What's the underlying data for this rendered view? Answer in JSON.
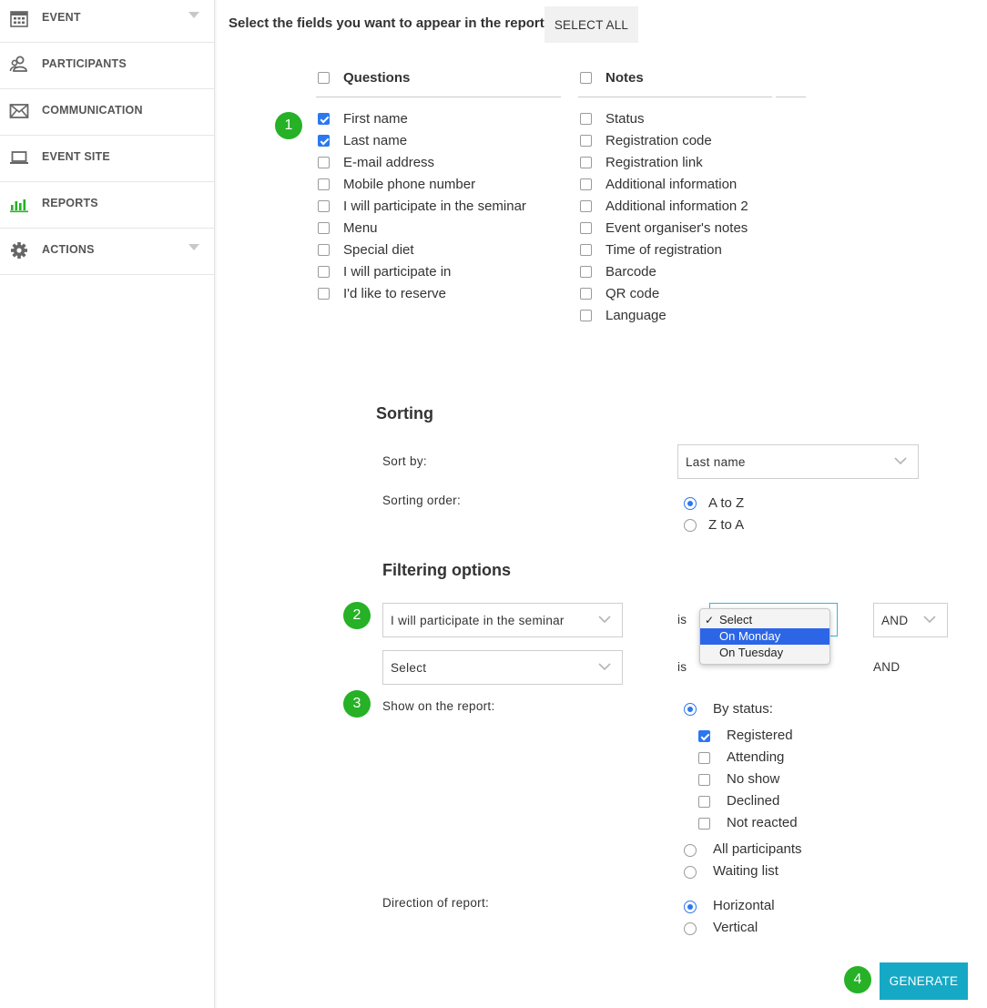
{
  "sidebar": {
    "items": [
      {
        "label": "EVENT",
        "icon": "calendar-icon",
        "has_caret": true
      },
      {
        "label": "PARTICIPANTS",
        "icon": "people-icon",
        "has_caret": false
      },
      {
        "label": "COMMUNICATION",
        "icon": "envelope-icon",
        "has_caret": false
      },
      {
        "label": "EVENT SITE",
        "icon": "laptop-icon",
        "has_caret": false
      },
      {
        "label": "REPORTS",
        "icon": "bar-chart-icon",
        "has_caret": false,
        "active": true
      },
      {
        "label": "ACTIONS",
        "icon": "gear-icon",
        "has_caret": true
      }
    ],
    "active_color": "#26b126"
  },
  "header": {
    "prompt": "Select the fields you want to appear in the report:",
    "select_all_label": "SELECT ALL"
  },
  "questions": {
    "heading": "Questions",
    "items": [
      {
        "label": "First name",
        "checked": true
      },
      {
        "label": "Last name",
        "checked": true
      },
      {
        "label": "E-mail address",
        "checked": false
      },
      {
        "label": "Mobile phone number",
        "checked": false
      },
      {
        "label": "I will participate in the seminar",
        "checked": false
      },
      {
        "label": "Menu",
        "checked": false
      },
      {
        "label": "Special diet",
        "checked": false
      },
      {
        "label": "I will participate in",
        "checked": false
      },
      {
        "label": "I'd like to reserve",
        "checked": false
      }
    ]
  },
  "notes": {
    "heading": "Notes",
    "items": [
      {
        "label": "Status",
        "checked": false
      },
      {
        "label": "Registration code",
        "checked": false
      },
      {
        "label": "Registration link",
        "checked": false
      },
      {
        "label": "Additional information",
        "checked": false
      },
      {
        "label": "Additional information 2",
        "checked": false
      },
      {
        "label": "Event organiser's notes",
        "checked": false
      },
      {
        "label": "Time of registration",
        "checked": false
      },
      {
        "label": "Barcode",
        "checked": false
      },
      {
        "label": "QR code",
        "checked": false
      },
      {
        "label": "Language",
        "checked": false
      }
    ]
  },
  "sorting": {
    "title": "Sorting",
    "sort_by_label": "Sort by:",
    "sort_by_value": "Last name",
    "order_label": "Sorting order:",
    "order_options": [
      {
        "label": "A to Z",
        "selected": true
      },
      {
        "label": "Z to A",
        "selected": false
      }
    ]
  },
  "filtering": {
    "title": "Filtering options",
    "rows": [
      {
        "field": "I will participate in the seminar",
        "is_label": "is",
        "conj": "AND"
      },
      {
        "field": "Select",
        "is_label": "is",
        "conj": "AND"
      }
    ],
    "dropdown_options": [
      {
        "label": "Select",
        "checked": true,
        "highlighted": false
      },
      {
        "label": "On Monday",
        "checked": false,
        "highlighted": true
      },
      {
        "label": "On Tuesday",
        "checked": false,
        "highlighted": false
      }
    ]
  },
  "show_on_report": {
    "label": "Show on the report:",
    "by_status_label": "By status:",
    "by_status_selected": true,
    "statuses": [
      {
        "label": "Registered",
        "checked": true
      },
      {
        "label": "Attending",
        "checked": false
      },
      {
        "label": "No show",
        "checked": false
      },
      {
        "label": "Declined",
        "checked": false
      },
      {
        "label": "Not reacted",
        "checked": false
      }
    ],
    "others": [
      {
        "label": "All participants",
        "selected": false
      },
      {
        "label": "Waiting list",
        "selected": false
      }
    ]
  },
  "direction": {
    "label": "Direction of report:",
    "options": [
      {
        "label": "Horizontal",
        "selected": true
      },
      {
        "label": "Vertical",
        "selected": false
      }
    ]
  },
  "badges": [
    "1",
    "2",
    "3",
    "4"
  ],
  "generate_label": "GENERATE",
  "colors": {
    "accent_blue": "#2b78f0",
    "badge_green": "#26b126",
    "generate_bg": "#16a9c6",
    "highlight": "#2c66e6"
  }
}
